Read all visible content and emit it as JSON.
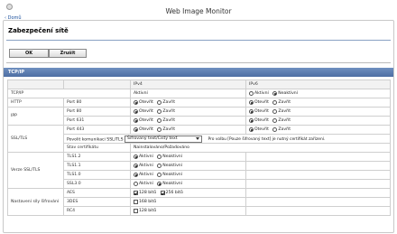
{
  "header": {
    "app_title": "Web Image Monitor",
    "back_link": "Domů"
  },
  "page": {
    "title": "Zabezpečení sítě"
  },
  "buttons": {
    "ok": "OK",
    "cancel": "Zrušit"
  },
  "section": {
    "title": "TCP/IP"
  },
  "table": {
    "col_ipv4": "IPv4",
    "col_ipv6": "IPv6",
    "tcpip_label": "TCP/IP",
    "tcpip_ipv4_value": "Aktivní",
    "opt_active": "Aktivní",
    "opt_inactive": "Neaktivní",
    "opt_open": "Otevřít",
    "opt_close": "Zavřít",
    "http_label": "HTTP",
    "ipp_label": "IPP",
    "ssltls_label": "SSL/TLS",
    "port80": "Port 80",
    "port631": "Port 631",
    "port443": "Port 443",
    "allow_comm_label": "Povolit komunikaci SSL/TLS",
    "allow_comm_value": "Šifrovaný text/Čistý text",
    "allow_comm_note": "Pro volbu [Pouze šifrovaný text] je nutný certifikát zařízení.",
    "cert_status_label": "Stav certifikátu",
    "cert_status_value": "Nainstalováno/Požadováno",
    "version_label": "Verze SSL/TLS",
    "tls12": "TLS1.2",
    "tls11": "TLS1.1",
    "tls10": "TLS1.0",
    "ssl30": "SSL3.0",
    "cipher_label": "Nastavení síly šifrování",
    "aes": "AES",
    "aes_128": "128 bitů",
    "aes_256": "256 bitů",
    "des3": "3DES",
    "des3_168": "168 bitů",
    "rc4": "RC4",
    "rc4_128": "128 bitů"
  }
}
